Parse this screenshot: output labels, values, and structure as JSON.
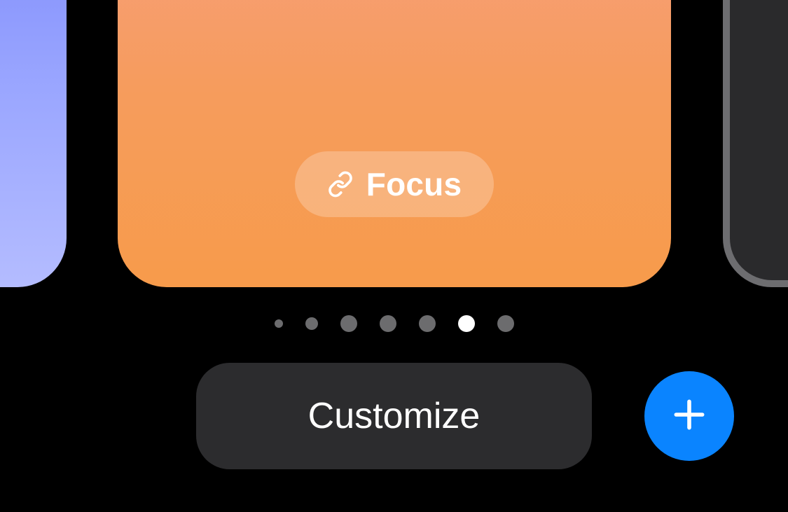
{
  "carousel": {
    "left_card": {
      "gradient": [
        "#6f7cf9",
        "#b4bcff"
      ]
    },
    "center_card": {
      "gradient": [
        "#f6a389",
        "#f79b4b"
      ],
      "pill": {
        "icon_name": "link-icon",
        "label": "Focus"
      }
    },
    "right_card": {
      "bg": "#2a2a2c",
      "border": "#6d6d70"
    }
  },
  "page_indicator": {
    "count": 7,
    "active_index": 5,
    "dot_color": "#6c6c6e",
    "active_color": "#ffffff"
  },
  "actions": {
    "customize_label": "Customize",
    "add_icon_name": "plus-icon",
    "add_bg": "#0a84ff"
  }
}
